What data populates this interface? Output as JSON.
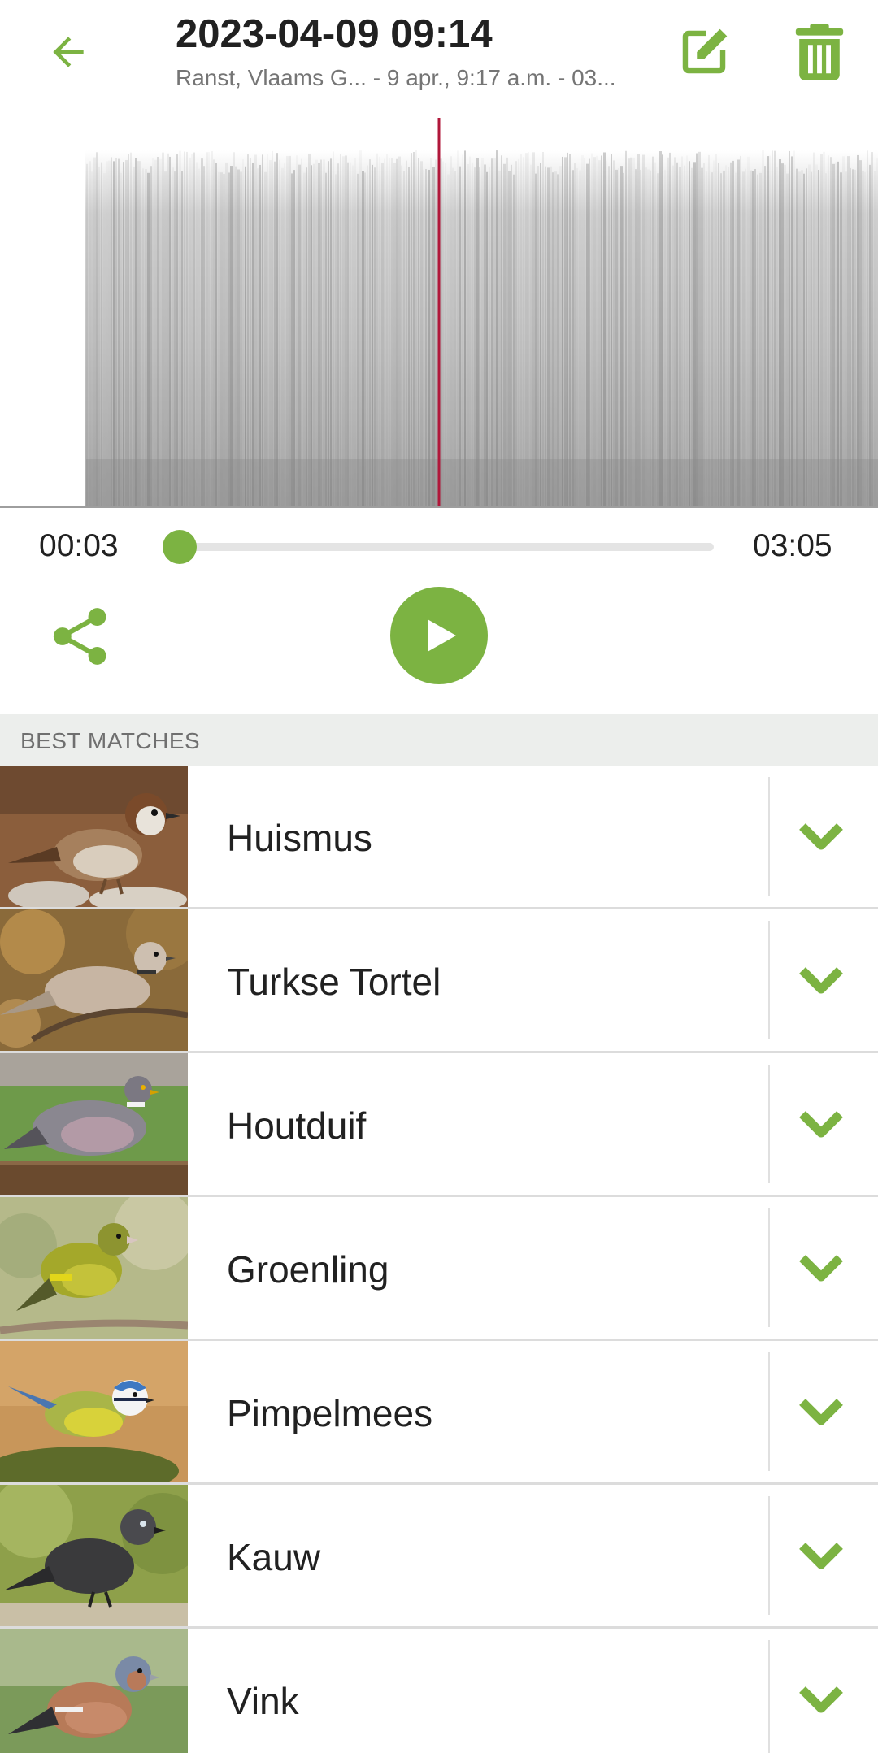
{
  "header": {
    "title": "2023-04-09 09:14",
    "subtitle": "Ranst, Vlaams G... - 9 apr., 9:17 a.m. - 03...",
    "back_icon": "arrow-left-icon",
    "edit_icon": "edit-icon",
    "delete_icon": "trash-icon"
  },
  "player": {
    "current_time": "00:03",
    "total_time": "03:05",
    "progress_fraction": 0.016,
    "share_icon": "share-icon",
    "play_icon": "play-icon"
  },
  "matches": {
    "section_label": "BEST MATCHES",
    "items": [
      {
        "name": "Huismus",
        "thumb": "house-sparrow"
      },
      {
        "name": "Turkse Tortel",
        "thumb": "collared-dove"
      },
      {
        "name": "Houtduif",
        "thumb": "wood-pigeon"
      },
      {
        "name": "Groenling",
        "thumb": "greenfinch"
      },
      {
        "name": "Pimpelmees",
        "thumb": "blue-tit"
      },
      {
        "name": "Kauw",
        "thumb": "jackdaw"
      },
      {
        "name": "Vink",
        "thumb": "chaffinch"
      }
    ]
  },
  "colors": {
    "accent": "#7cb342",
    "playhead": "#b0173a",
    "section_bg": "#eceeec"
  }
}
